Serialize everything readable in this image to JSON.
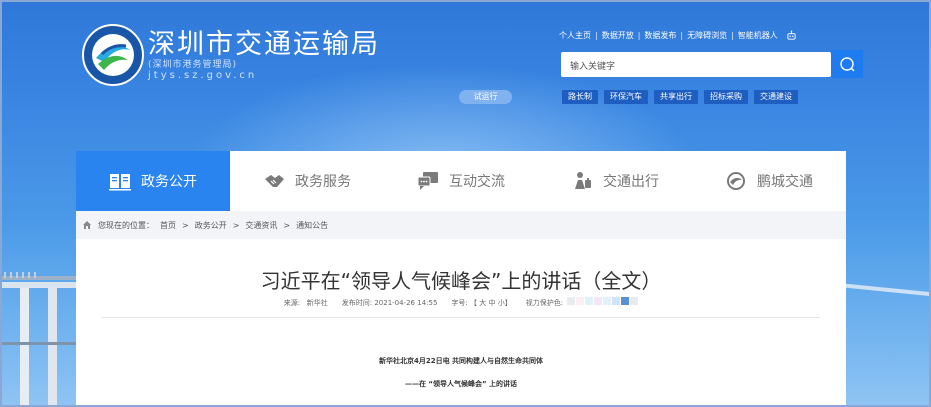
{
  "header": {
    "site_name": "深圳市交通运输局",
    "site_subtitle": "(深圳市港务管理局)",
    "site_domain": "jtys.sz.gov.cn",
    "top_links": [
      "个人主页",
      "数据开放",
      "数据发布",
      "无障碍浏览",
      "智能机器人"
    ],
    "search_placeholder": "输入关键字",
    "trial_label": "试运行",
    "quick_links": [
      "路长制",
      "环保汽车",
      "共享出行",
      "招标采购",
      "交通建设"
    ]
  },
  "nav": {
    "items": [
      {
        "label": "政务公开",
        "icon": "book-icon",
        "active": true
      },
      {
        "label": "政务服务",
        "icon": "handshake-icon",
        "active": false
      },
      {
        "label": "互动交流",
        "icon": "chat-icon",
        "active": false
      },
      {
        "label": "交通出行",
        "icon": "traveler-icon",
        "active": false
      },
      {
        "label": "鹏城交通",
        "icon": "swirl-icon",
        "active": false
      }
    ]
  },
  "breadcrumb": {
    "prefix": "您现在的位置：",
    "items": [
      "首页",
      "政务公开",
      "交通资讯",
      "通知公告"
    ],
    "separator": ">"
  },
  "article": {
    "title": "习近平在“领导人气候峰会”上的讲话（全文）",
    "source_label": "来源:",
    "source_value": "新华社",
    "date_text": "发布时间: 2021-04-26 14:55",
    "font_size_label": "字号:",
    "font_sizes": "【 大 中 小】",
    "eye_label": "视力保护色:",
    "eye_colors": [
      "#e9ecef",
      "#fbeff4",
      "#dff3f7",
      "#f3e6f7",
      "#e2f0fb",
      "#cfe4fa",
      "#5a8fd8",
      "#e8eaee"
    ],
    "para1": "新华社北京4月22日电 共同构建人与自然生命共同体",
    "para2": "——在 “领导人气候峰会” 上的讲话"
  },
  "colors": {
    "nav_active": "#2a84f0",
    "search_button": "#1e7cf0",
    "quick_link_bg": "#1e5ec0"
  }
}
